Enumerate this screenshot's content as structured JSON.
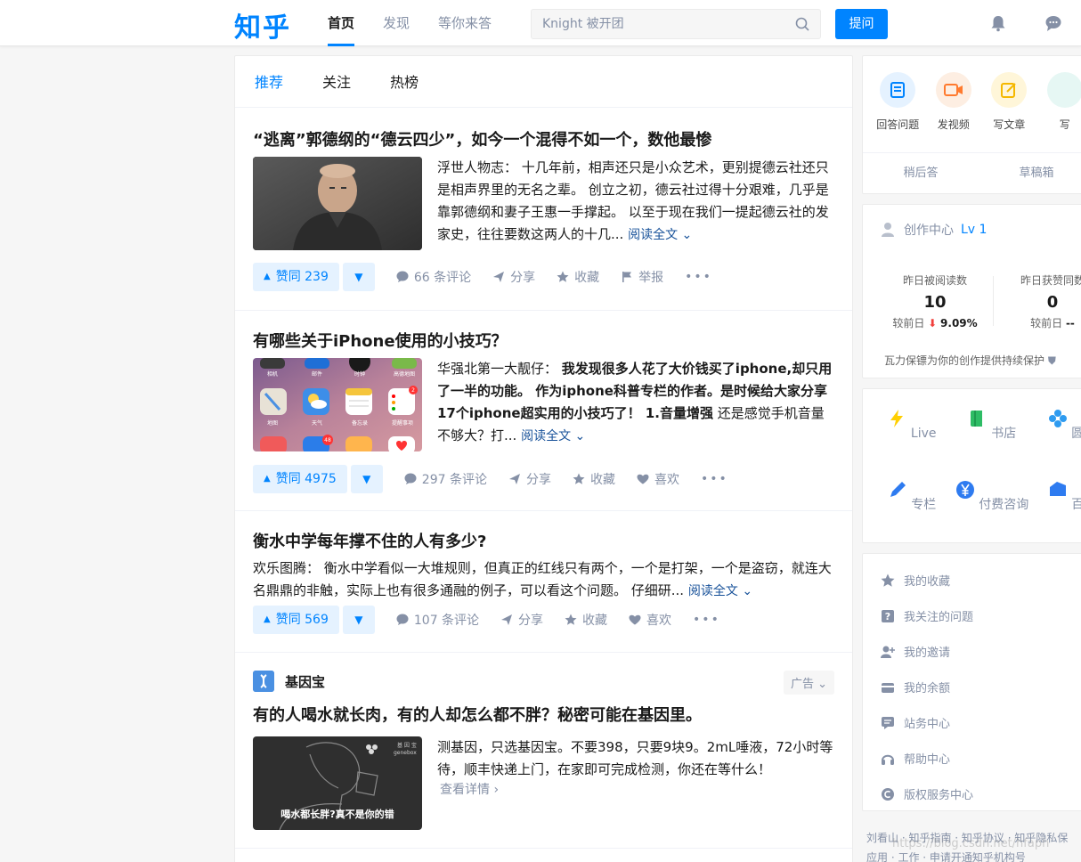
{
  "header": {
    "logo": "知乎",
    "nav": [
      "首页",
      "发现",
      "等你来答"
    ],
    "search_placeholder": "Knight 被开团",
    "ask_label": "提问"
  },
  "feed": {
    "tabs": [
      "推荐",
      "关注",
      "热榜"
    ],
    "items": [
      {
        "title": "“逃离”郭德纲的“德云四少”，如今一个混得不如一个，数他最惨",
        "author": "浮世人物志：",
        "excerpt": "十几年前，相声还只是小众艺术，更别提德云社还只是相声界里的无名之辈。 创立之初，德云社过得十分艰难，几乎是靠郭德纲和妻子王惠一手撑起。 以至于现在我们一提起德云社的发家史，往往要数这两人的十几...",
        "read_more": "阅读全文",
        "vote_label": "赞同 239",
        "comments": "66 条评论",
        "share": "分享",
        "collect": "收藏",
        "extra": "举报"
      },
      {
        "title": "有哪些关于iPhone使用的小技巧？",
        "author": "华强北第一大靓仔：",
        "excerpt_bold": "我发现很多人花了大价钱买了iphone,却只用了一半的功能。 作为iphone科普专栏的作者。是时候给大家分享17个iphone超实用的小技巧了！ 1.音量增强",
        "excerpt": " 还是感觉手机音量不够大？打...",
        "read_more": "阅读全文",
        "vote_label": "赞同 4975",
        "comments": "297 条评论",
        "share": "分享",
        "collect": "收藏",
        "extra": "喜欢"
      },
      {
        "title": "衡水中学每年撑不住的人有多少?",
        "author": "欢乐图腾：",
        "excerpt": "衡水中学看似一大堆规则，但真正的红线只有两个，一个是打架，一个是盗窃，就连大名鼎鼎的非触，实际上也有很多通融的例子，可以看这个问题。 仔细研...",
        "read_more": "阅读全文",
        "vote_label": "赞同 569",
        "comments": "107 条评论",
        "share": "分享",
        "collect": "收藏",
        "extra": "喜欢"
      }
    ],
    "ad": {
      "brand": "基因宝",
      "tag": "广告",
      "title": "有的人喝水就长肉，有的人却怎么都不胖？秘密可能在基因里。",
      "excerpt": "测基因，只选基因宝。不要398，只要9块9。2mL唾液，72小时等待，顺丰快递上门，在家即可完成检测，你还在等什么！",
      "link": "查看详情",
      "image_caption": "喝水都长胖?真不是你的错",
      "image_brand": "基 因 宝",
      "image_brand_en": "genebox"
    }
  },
  "thumbs": {
    "iphone_apps": [
      "相机",
      "邮件",
      "时钟",
      "高德地图",
      "地图",
      "天气",
      "备忘录",
      "提醒事项"
    ],
    "badge": "48",
    "badge2": "2"
  },
  "sidebar": {
    "create": [
      "回答问题",
      "发视频",
      "写文章",
      "写"
    ],
    "drafts": [
      "稍后答",
      "草稿箱"
    ],
    "creator": {
      "title": "创作中心",
      "level": "Lv 1",
      "reads_label": "昨日被阅读数",
      "reads_value": "10",
      "reads_cmp_label": "较前日",
      "reads_cmp_value": "9.09%",
      "likes_label": "昨日获赞同数",
      "likes_value": "0",
      "likes_cmp_label": "较前日",
      "likes_cmp_value": "--",
      "footer": "瓦力保镖为你的创作提供持续保护"
    },
    "grid": [
      "Live",
      "书店",
      "圆桌",
      "专栏",
      "付费咨询",
      "百科"
    ],
    "links": [
      "我的收藏",
      "我关注的问题",
      "我的邀请",
      "我的余额",
      "站务中心",
      "帮助中心",
      "版权服务中心"
    ],
    "footer_line1": "刘看山 · 知乎指南 · 知乎协议 · 知乎隐私保",
    "footer_line2": "应用 · 工作 · 申请开通知乎机构号",
    "watermark": "https://blog.csdn.net/hfaph"
  },
  "colors": {
    "brand": "#0084ff",
    "vote_bg": "#e5f2ff",
    "decrease": "#f1403c"
  }
}
